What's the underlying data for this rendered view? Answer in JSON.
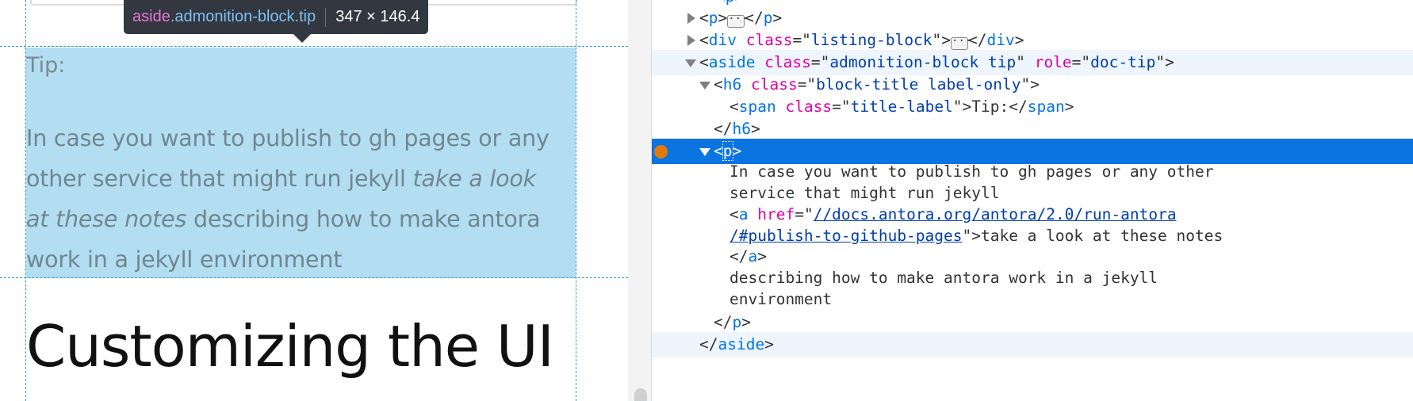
{
  "preview": {
    "tooltip": {
      "tag": "aside",
      "selector": ".admonition-block.tip",
      "dimensions": "347 × 146.4"
    },
    "tip_label": "Tip:",
    "tip_text": {
      "line1": "In case you want to publish to gh pages or any",
      "line2_plain": "other service that might run jekyll ",
      "line2_em": "take a look",
      "line3_em": "at these notes",
      "line3_plain": " describing how to make antora",
      "line4": "work in a jekyll environment"
    },
    "heading": "Customizing the UI"
  },
  "markup": {
    "rows": {
      "p_collapsed": {
        "open": "<",
        "tag": "p",
        "close": ">",
        "end": "</",
        "end_close": ">"
      },
      "div_listing": {
        "tag": "div",
        "attr": "class",
        "eq": "=\"",
        "value": "listing-block",
        "q": "\""
      },
      "aside": {
        "tag": "aside",
        "attr1": "class",
        "value1": "admonition-block tip",
        "attr2": "role",
        "value2": "doc-tip"
      },
      "h6": {
        "tag": "h6",
        "attr": "class",
        "value": "block-title label-only"
      },
      "span": {
        "tag": "span",
        "attr": "class",
        "value": "title-label",
        "text": "Tip:"
      },
      "h6_close": {
        "tag": "h6"
      },
      "p_selected": {
        "tag": "p"
      },
      "text1": "In case you want to publish to gh pages or any other",
      "text2": "service that might run jekyll",
      "a": {
        "tag": "a",
        "attr": "href",
        "href1": "//docs.antora.org/antora/2.0/run-antora",
        "href2": "/#publish-to-github-pages",
        "text": "take a look at these notes"
      },
      "a_close": {
        "tag": "a"
      },
      "text3": "describing how to make antora work in a jekyll",
      "text4": "environment",
      "p_close": {
        "tag": "p"
      },
      "aside_close": {
        "tag": "aside"
      }
    }
  },
  "colors": {
    "highlight": "#b3ddf1",
    "selected_row": "#0a74e0",
    "tag": "#0074e8",
    "attribute": "#dd00a9",
    "value": "#003eaa",
    "breakpoint": "#e27a0b"
  }
}
